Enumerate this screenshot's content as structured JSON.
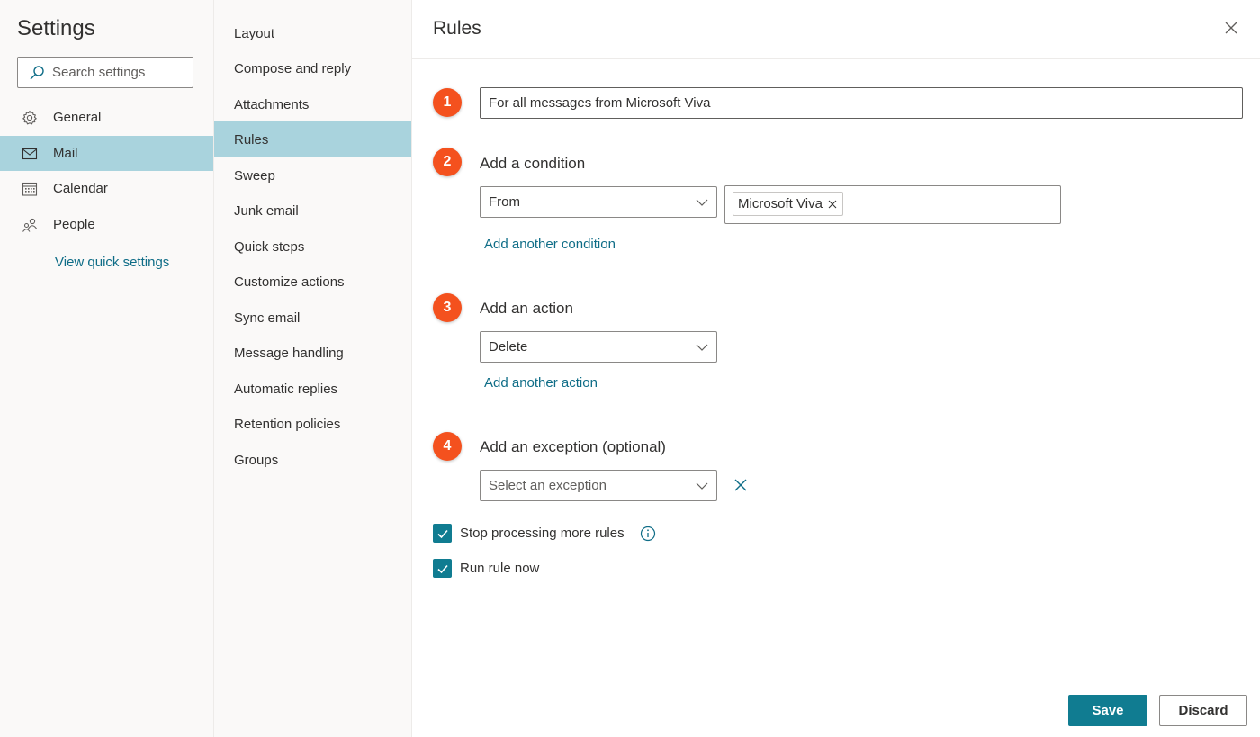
{
  "left_nav": {
    "title": "Settings",
    "search_placeholder": "Search settings",
    "items": [
      {
        "label": "General",
        "icon": "gear-icon",
        "active": false
      },
      {
        "label": "Mail",
        "icon": "mail-icon",
        "active": true
      },
      {
        "label": "Calendar",
        "icon": "calendar-icon",
        "active": false
      },
      {
        "label": "People",
        "icon": "people-icon",
        "active": false
      }
    ],
    "quick_settings": "View quick settings"
  },
  "sub_nav": {
    "items": [
      {
        "label": "Layout",
        "active": false
      },
      {
        "label": "Compose and reply",
        "active": false
      },
      {
        "label": "Attachments",
        "active": false
      },
      {
        "label": "Rules",
        "active": true
      },
      {
        "label": "Sweep",
        "active": false
      },
      {
        "label": "Junk email",
        "active": false
      },
      {
        "label": "Quick steps",
        "active": false
      },
      {
        "label": "Customize actions",
        "active": false
      },
      {
        "label": "Sync email",
        "active": false
      },
      {
        "label": "Message handling",
        "active": false
      },
      {
        "label": "Automatic replies",
        "active": false
      },
      {
        "label": "Retention policies",
        "active": false
      },
      {
        "label": "Groups",
        "active": false
      }
    ]
  },
  "rules": {
    "title": "Rules",
    "steps": [
      "1",
      "2",
      "3",
      "4"
    ],
    "rule_name": "For all messages from Microsoft Viva",
    "condition": {
      "label": "Add a condition",
      "selected": "From",
      "chip": "Microsoft Viva",
      "add_link": "Add another condition"
    },
    "action": {
      "label": "Add an action",
      "selected": "Delete",
      "add_link": "Add another action"
    },
    "exception": {
      "label": "Add an exception (optional)",
      "placeholder": "Select an exception"
    },
    "stop_processing": {
      "label": "Stop processing more rules",
      "checked": true
    },
    "run_now": {
      "label": "Run rule now",
      "checked": true
    },
    "save_label": "Save",
    "discard_label": "Discard"
  },
  "colors": {
    "accent": "#107c91",
    "active_nav": "#a9d3dd",
    "step_badge": "#f4511e",
    "link": "#0f6d87"
  }
}
